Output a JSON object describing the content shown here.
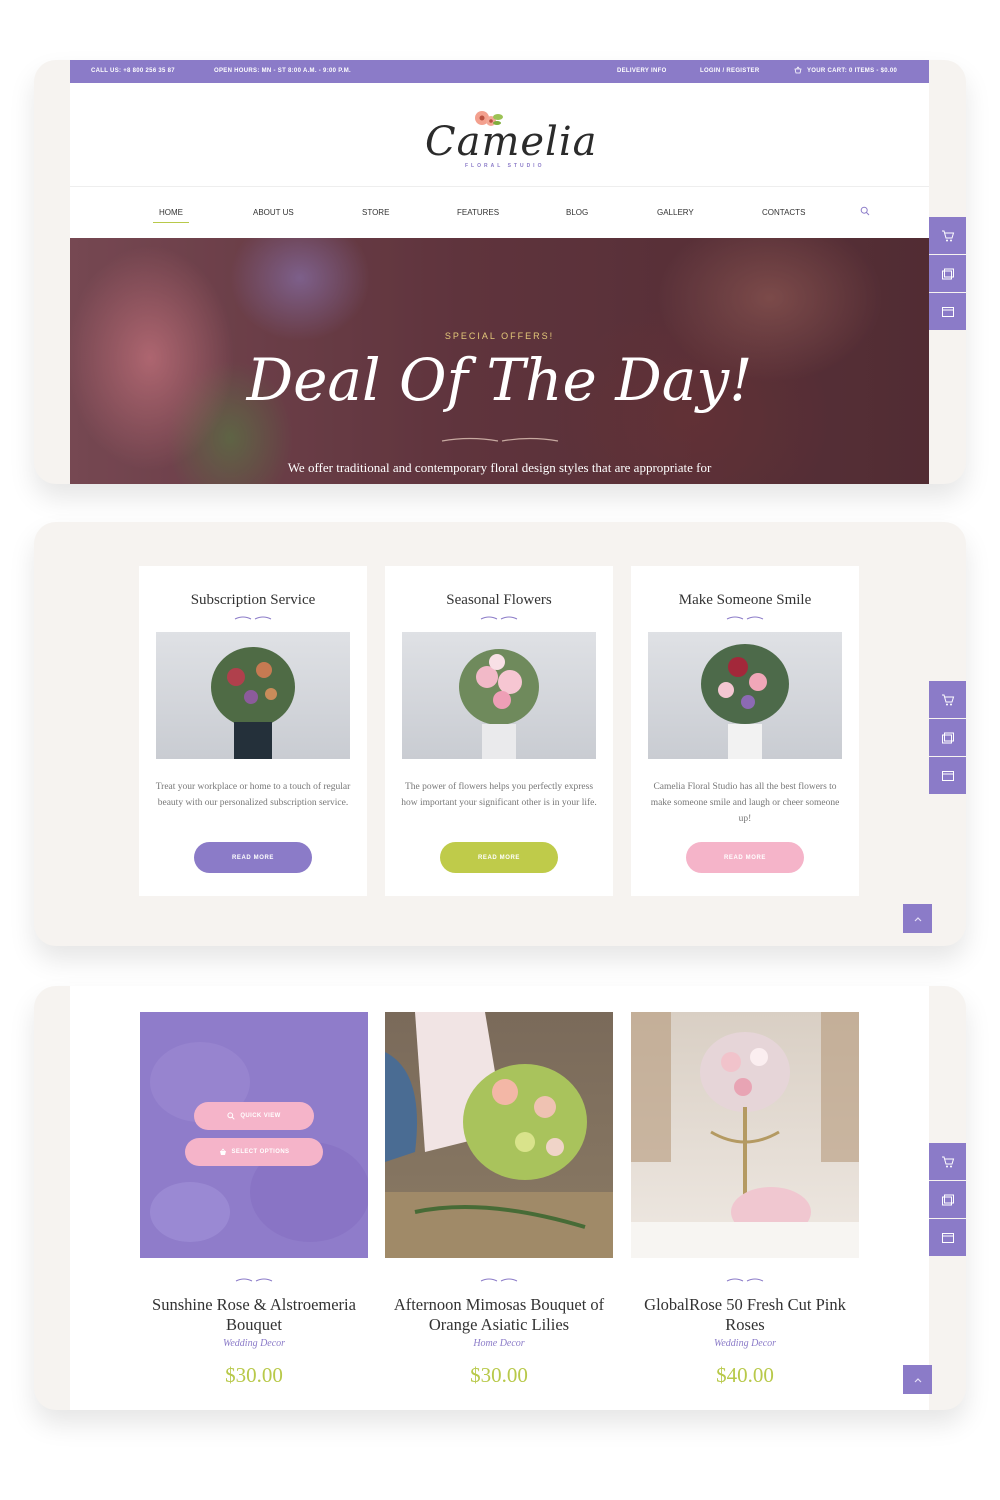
{
  "colors": {
    "accent": "#8b7bc8",
    "green": "#b8c94a",
    "pink": "#f5b4c9",
    "panel_bg": "#f6f3f0"
  },
  "topbar": {
    "call": "CALL US: +8 800 256 35 87",
    "hours": "OPEN HOURS: MN - ST 8:00 A.M. - 9:00 P.M.",
    "delivery": "DELIVERY INFO",
    "login": "LOGIN / REGISTER",
    "cart": "YOUR CART:  0 ITEMS - $0.00"
  },
  "logo": {
    "name": "Camelia",
    "tagline": "FLORAL STUDIO"
  },
  "nav": {
    "items": [
      {
        "label": "HOME",
        "active": true
      },
      {
        "label": "ABOUT US"
      },
      {
        "label": "STORE"
      },
      {
        "label": "FEATURES"
      },
      {
        "label": "BLOG"
      },
      {
        "label": "GALLERY"
      },
      {
        "label": "CONTACTS"
      }
    ],
    "search_icon": "search-icon"
  },
  "hero": {
    "eyebrow": "SPECIAL OFFERS!",
    "title": "Deal Of The Day!",
    "text": "We offer traditional and contemporary floral design styles that are appropriate for"
  },
  "side_tools": [
    "cart-icon",
    "gallery-icon",
    "window-icon"
  ],
  "services": [
    {
      "title": "Subscription Service",
      "text": "Treat your workplace or home to a touch of regular beauty with our personalized subscription service.",
      "button": "READ MORE",
      "button_color": "#8b7bc8"
    },
    {
      "title": "Seasonal Flowers",
      "text": "The power of flowers helps you perfectly express how important your significant other is in your life.",
      "button": "READ MORE",
      "button_color": "#bfcb4a"
    },
    {
      "title": "Make Someone Smile",
      "text": "Camelia Floral Studio has all the best flowers to make someone smile and laugh or cheer someone up!",
      "button": "READ MORE",
      "button_color": "#f5b4c9"
    }
  ],
  "products": [
    {
      "name": "Sunshine Rose & Alstroemeria Bouquet",
      "category": "Wedding Decor",
      "price": "$30.00",
      "quick_view": "QUICK VIEW",
      "select_options": "SELECT OPTIONS"
    },
    {
      "name": "Afternoon Mimosas Bouquet of Orange Asiatic Lilies",
      "category": "Home Decor",
      "price": "$30.00"
    },
    {
      "name": "GlobalRose 50 Fresh Cut Pink Roses",
      "category": "Wedding Decor",
      "price": "$40.00"
    }
  ]
}
